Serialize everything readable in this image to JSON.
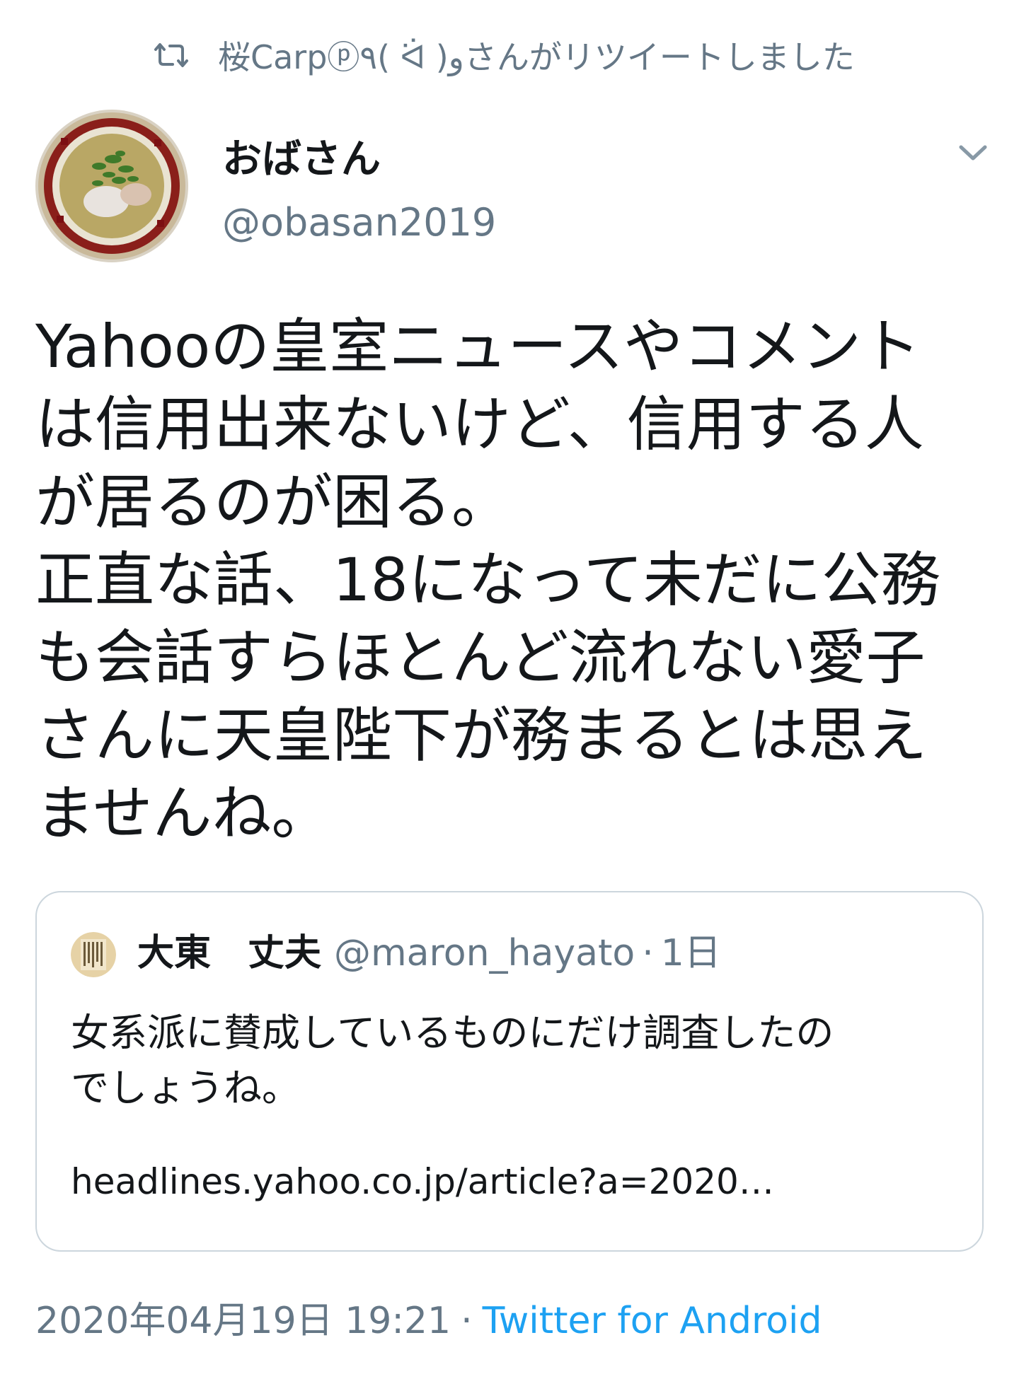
{
  "retweet_header": {
    "icon": "retweet-icon",
    "text": "桜Carpⓟ٩( ᐛ )وさんがリツイートしました"
  },
  "author": {
    "avatar": "ramen-bowl-avatar",
    "name": "おばさん",
    "handle": "@obasan2019",
    "menu_icon": "chevron-down-icon"
  },
  "tweet": {
    "text": "Yahooの皇室ニュースやコメント\nは信用出来ないけど、信用する人\nが居るのが困る。\n正直な話、18になって未だに公務\nも会話すらほとんど流れない愛子\nさんに天皇陛下が務まるとは思え\nませんね。"
  },
  "quoted_tweet": {
    "avatar": "document-avatar",
    "name": "大東　丈夫",
    "handle": "@maron_hayato",
    "separator": "·",
    "time": "1日",
    "text": "女系派に賛成しているものにだけ調査したの\nでしょうね。",
    "link": "headlines.yahoo.co.jp/article?a=2020…"
  },
  "footer": {
    "timestamp": "2020年04月19日 19:21",
    "separator": "·",
    "source": "Twitter for Android"
  },
  "colors": {
    "text_primary": "#14171a",
    "text_secondary": "#657786",
    "link": "#1da1f2",
    "border": "#ccd6dd"
  }
}
